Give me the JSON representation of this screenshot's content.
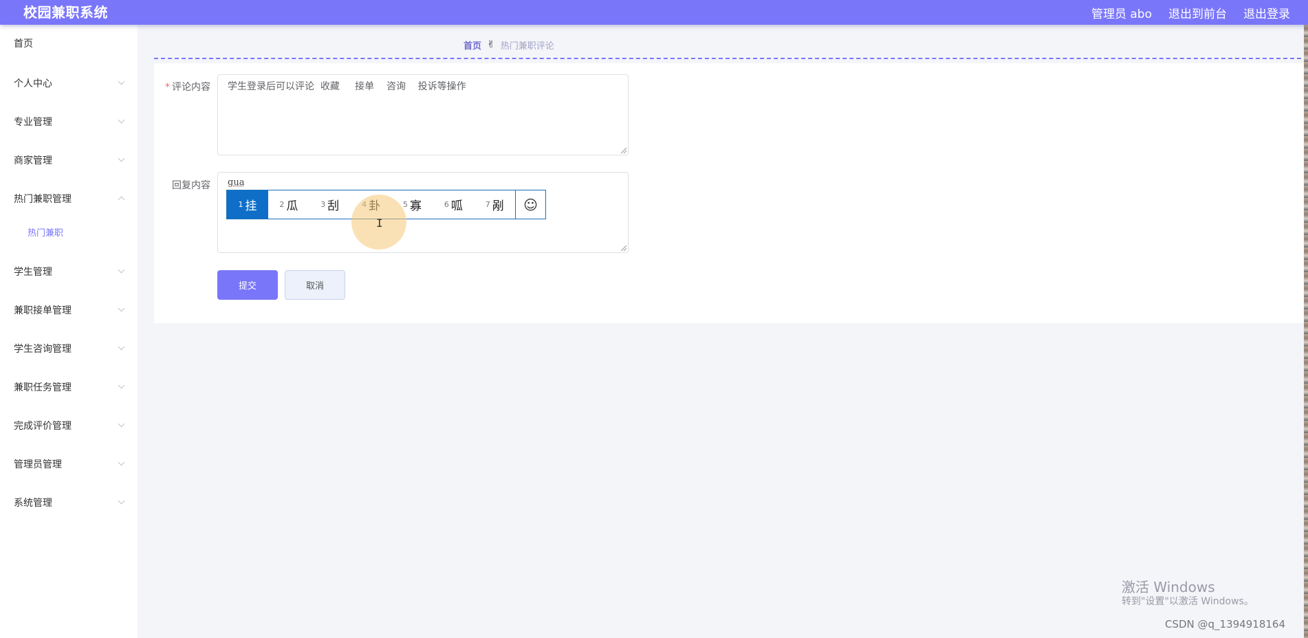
{
  "header": {
    "brand": "校园兼职系统",
    "admin": "管理员 abo",
    "exit_front": "退出到前台",
    "logout": "退出登录"
  },
  "sidebar": {
    "items": [
      {
        "label": "首页"
      },
      {
        "label": "个人中心"
      },
      {
        "label": "专业管理"
      },
      {
        "label": "商家管理"
      },
      {
        "label": "热门兼职管理"
      },
      {
        "label": "学生管理"
      },
      {
        "label": "兼职接单管理"
      },
      {
        "label": "学生咨询管理"
      },
      {
        "label": "兼职任务管理"
      },
      {
        "label": "完成评价管理"
      },
      {
        "label": "管理员管理"
      },
      {
        "label": "系统管理"
      }
    ],
    "sub_item": "热门兼职"
  },
  "breadcrumb": {
    "home": "首页",
    "separator": "✌",
    "current": "热门兼职评论"
  },
  "form": {
    "comment_label": "评论内容",
    "comment_value": "学生登录后可以评论  收藏     接单    咨询    投诉等操作",
    "reply_label": "回复内容",
    "reply_composition": "gua",
    "submit": "提交",
    "cancel": "取消"
  },
  "ime": {
    "candidates": [
      {
        "num": "1",
        "char": "挂"
      },
      {
        "num": "2",
        "char": "瓜"
      },
      {
        "num": "3",
        "char": "刮"
      },
      {
        "num": "4",
        "char": "卦"
      },
      {
        "num": "5",
        "char": "寡"
      },
      {
        "num": "6",
        "char": "呱"
      },
      {
        "num": "7",
        "char": "剐"
      }
    ],
    "emoji_icon": "☺"
  },
  "watermark": {
    "line1": "激活 Windows",
    "line2": "转到\"设置\"以激活 Windows。",
    "csdn": "CSDN @q_1394918164"
  },
  "colors": {
    "accent": "#7a76fa",
    "ime_selected": "#0f6fc8"
  }
}
